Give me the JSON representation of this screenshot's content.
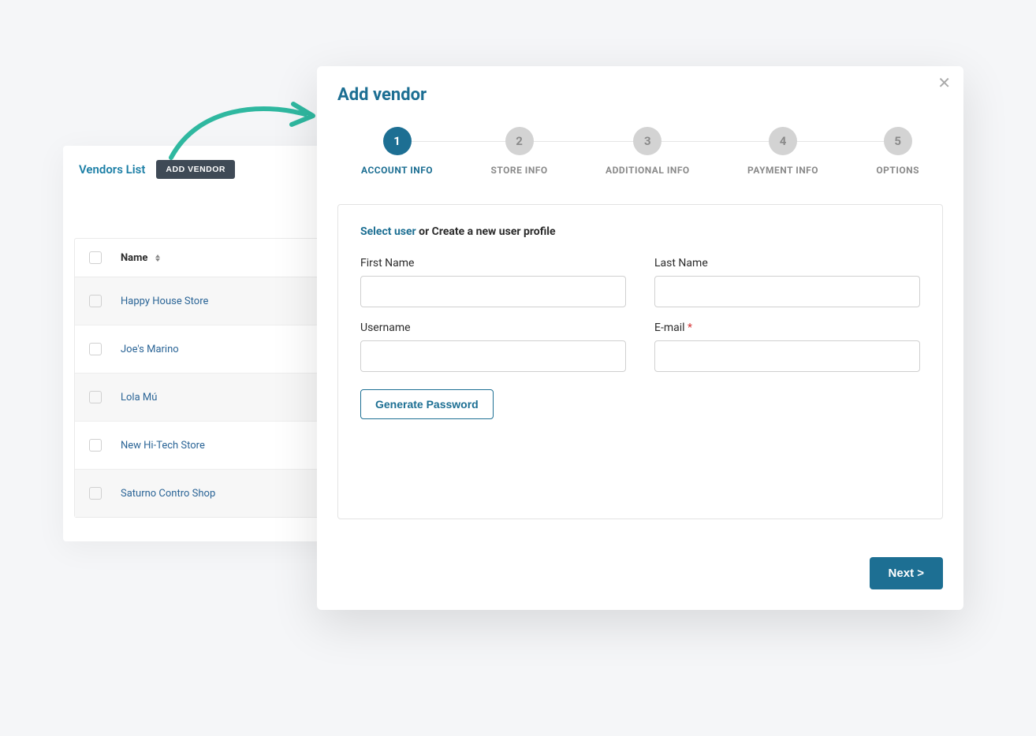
{
  "vendors": {
    "title": "Vendors List",
    "add_button": "ADD VENDOR",
    "name_header": "Name",
    "rows": [
      {
        "name": "Happy House Store"
      },
      {
        "name": "Joe's Marino"
      },
      {
        "name": "Lola Mú"
      },
      {
        "name": "New Hi-Tech Store"
      },
      {
        "name": "Saturno Contro Shop"
      }
    ]
  },
  "modal": {
    "title": "Add vendor",
    "steps": [
      {
        "num": "1",
        "label": "ACCOUNT INFO"
      },
      {
        "num": "2",
        "label": "STORE INFO"
      },
      {
        "num": "3",
        "label": "ADDITIONAL INFO"
      },
      {
        "num": "4",
        "label": "PAYMENT INFO"
      },
      {
        "num": "5",
        "label": "OPTIONS"
      }
    ],
    "select_user": "Select user",
    "create_profile": " or Create a new user profile",
    "fields": {
      "first_name": "First Name",
      "last_name": "Last Name",
      "username": "Username",
      "email": "E-mail"
    },
    "generate_password": "Generate Password",
    "next": "Next >"
  }
}
